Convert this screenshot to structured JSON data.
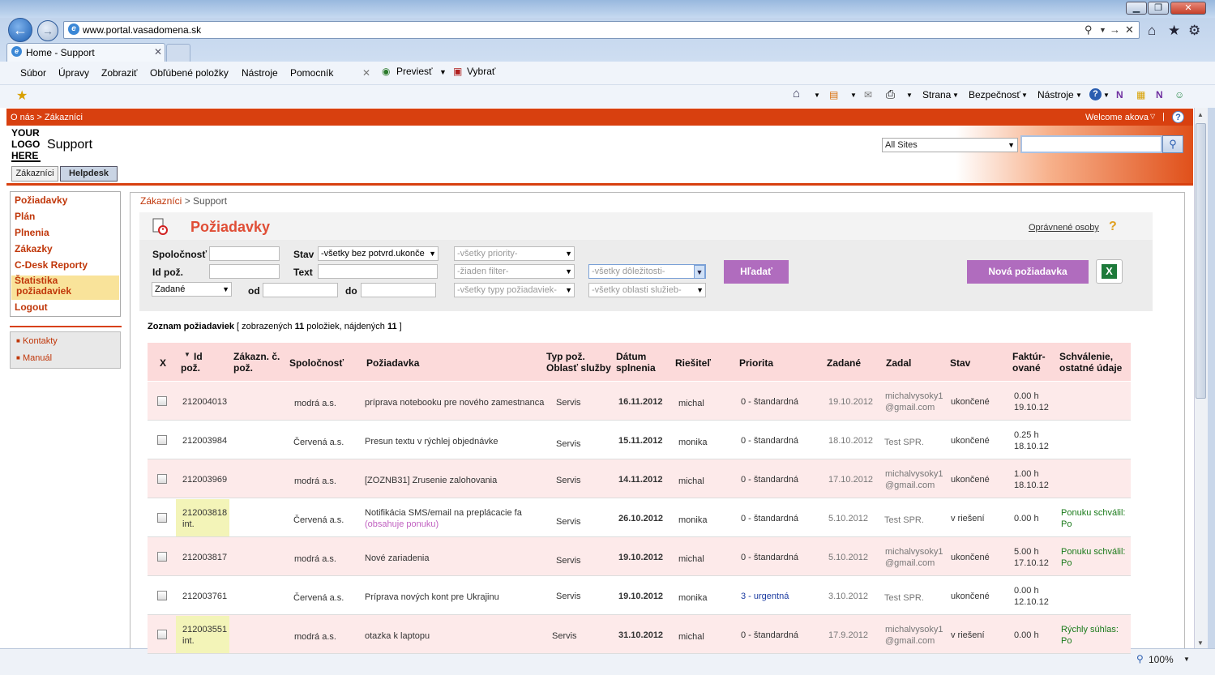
{
  "browser": {
    "url": "www.portal.vasadomena.sk",
    "tab_title": "Home - Support",
    "menu": [
      "Súbor",
      "Úpravy",
      "Zobraziť",
      "Obľúbené položky",
      "Nástroje",
      "Pomocník"
    ],
    "cmd_previest": "Previesť",
    "cmd_vybrat": "Vybrať",
    "cmd_strana": "Strana",
    "cmd_bezpecnost": "Bezpečnosť",
    "cmd_nastroje": "Nástroje",
    "zoom": "100%"
  },
  "site": {
    "breadcrumb_top": "O nás > Zákazníci",
    "welcome": "Welcome akova",
    "logo": "YOUR LOGO HERE",
    "title": "Support",
    "sites_select": "All Sites",
    "tabs": [
      "Zákazníci",
      "Helpdesk"
    ]
  },
  "nav": {
    "items": [
      "Požiadavky",
      "Plán",
      "Plnenia",
      "Zákazky",
      "C-Desk Reporty",
      "Štatistika",
      "požiadaviek",
      "Logout"
    ],
    "secondary": [
      "Kontakty",
      "Manuál"
    ]
  },
  "main": {
    "crumb_link": "Zákazníci",
    "crumb_rest": " > Support",
    "title": "Požiadavky",
    "opravnene": "Oprávnené osoby",
    "help": "?"
  },
  "filters": {
    "spolocnost_label": "Spoločnosť",
    "id_label": "Id pož.",
    "stav_label": "Stav",
    "text_label": "Text",
    "od_label": "od",
    "do_label": "do",
    "stav_value": "-všetky bez potvrd.ukonče",
    "date_type": "Zadané",
    "priority": "-všetky priority-",
    "filter": "-žiaden filter-",
    "types": "-všetky typy požiadaviek-",
    "importance": "-všetky dôležitosti-",
    "areas": "-všetky oblasti služieb-",
    "search_btn": "Hľadať",
    "new_btn": "Nová požiadavka"
  },
  "list": {
    "title_prefix": "Zoznam požiadaviek",
    "title_mid1": " [ zobrazených ",
    "shown": "11",
    "title_mid2": " položiek, nájdených ",
    "found": "11",
    "title_end": " ]"
  },
  "table": {
    "headers": {
      "x": "X",
      "id": "Id",
      "id2": "pož.",
      "zak": "Zákazn. č.",
      "zak2": "pož.",
      "spol": "Spoločnosť",
      "poz": "Požiadavka",
      "typ": "Typ pož.",
      "typ2": "Oblasť služby",
      "dat": "Dátum",
      "dat2": "splnenia",
      "ries": "Riešiteľ",
      "prio": "Priorita",
      "zad": "Zadané",
      "zadal": "Zadal",
      "stav": "Stav",
      "fakt": "Faktúr-",
      "fakt2": "ované",
      "schv": "Schválenie,",
      "schv2": "ostatné údaje"
    },
    "rows": [
      {
        "id": "212004013",
        "int": "",
        "company": "modrá a.s.",
        "request": "príprava notebooku pre nového zamestnanca",
        "note": "",
        "type": "Servis",
        "due": "16.11.2012",
        "solver": "michal",
        "priority": "0 - štandardná",
        "created": "19.10.2012",
        "by1": "michalvysoky1",
        "by2": "@gmail.com",
        "state": "ukončené",
        "h": "0.00 h",
        "hdate": "19.10.12",
        "approval1": "",
        "approval2": ""
      },
      {
        "id": "212003984",
        "int": "",
        "company": "Červená a.s.",
        "request": "Presun textu v rýchlej objednávke",
        "note": "",
        "type": "Servis",
        "due": "15.11.2012",
        "solver": "monika",
        "priority": "0 - štandardná",
        "created": "18.10.2012",
        "by1": "Test SPR.",
        "by2": "",
        "state": "ukončené",
        "h": "0.25 h",
        "hdate": "18.10.12",
        "approval1": "",
        "approval2": ""
      },
      {
        "id": "212003969",
        "int": "",
        "company": "modrá a.s.",
        "request": "[ZOZNB31] Zrusenie zalohovania",
        "note": "",
        "type": "Servis",
        "due": "14.11.2012",
        "solver": "michal",
        "priority": "0 - štandardná",
        "created": "17.10.2012",
        "by1": "michalvysoky1",
        "by2": "@gmail.com",
        "state": "ukončené",
        "h": "1.00 h",
        "hdate": "18.10.12",
        "approval1": "",
        "approval2": ""
      },
      {
        "id": "212003818",
        "int": "int.",
        "company": "Červená a.s.",
        "request": "Notifikácia SMS/email na preplácacie fa",
        "note": "(obsahuje ponuku)",
        "type": "Servis",
        "due": "26.10.2012",
        "solver": "monika",
        "priority": "0 - štandardná",
        "created": "5.10.2012",
        "by1": "Test SPR.",
        "by2": "",
        "state": "v riešení",
        "h": "0.00 h",
        "hdate": "",
        "approval1": "Ponuku schválil:",
        "approval2": "Po"
      },
      {
        "id": "212003817",
        "int": "",
        "company": "modrá a.s.",
        "request": "Nové zariadenia",
        "note": "",
        "type": "Servis",
        "due": "19.10.2012",
        "solver": "michal",
        "priority": "0 - štandardná",
        "created": "5.10.2012",
        "by1": "michalvysoky1",
        "by2": "@gmail.com",
        "state": "ukončené",
        "h": "5.00 h",
        "hdate": "17.10.12",
        "approval1": "Ponuku schválil:",
        "approval2": "Po"
      },
      {
        "id": "212003761",
        "int": "",
        "company": "Červená a.s.",
        "request": "Príprava nových kont pre Ukrajinu",
        "note": "",
        "type": "Servis",
        "due": "19.10.2012",
        "solver": "monika",
        "priority": "3 - urgentná",
        "created": "3.10.2012",
        "by1": "Test SPR.",
        "by2": "",
        "state": "ukončené",
        "h": "0.00 h",
        "hdate": "12.10.12",
        "approval1": "",
        "approval2": ""
      },
      {
        "id": "212003551",
        "int": "int.",
        "company": "modrá a.s.",
        "request": "otazka k laptopu",
        "note": "",
        "type": "Servis",
        "due": "31.10.2012",
        "solver": "michal",
        "priority": "0 - štandardná",
        "created": "17.9.2012",
        "by1": "michalvysoky1",
        "by2": "@gmail.com",
        "state": "v riešení",
        "h": "0.00 h",
        "hdate": "",
        "approval1": "Rýchly súhlas:",
        "approval2": "Po"
      }
    ]
  }
}
